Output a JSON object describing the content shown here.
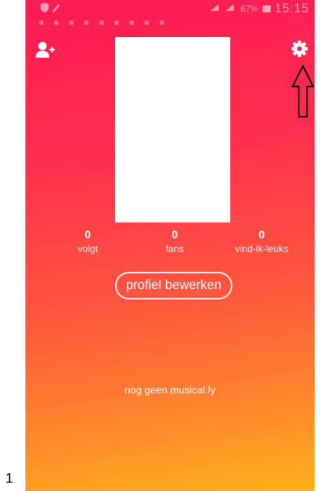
{
  "status_bar": {
    "battery": "67%",
    "time": "15:15"
  },
  "profile": {
    "stats": [
      {
        "value": "0",
        "label": "volgt"
      },
      {
        "value": "0",
        "label": "fans"
      },
      {
        "value": "0",
        "label": "vind-ik-leuks"
      }
    ],
    "edit_button_label": "profiel bewerken",
    "empty_message": "nog geen musical.ly"
  },
  "icons": {
    "top_left": "add-user-icon",
    "top_right": "gear-icon",
    "annotation": "arrow-up-icon"
  },
  "page_number": "1",
  "colors": {
    "gradient_top": "#ff1a54",
    "gradient_bottom": "#ffb11a",
    "text": "#ffffff"
  }
}
